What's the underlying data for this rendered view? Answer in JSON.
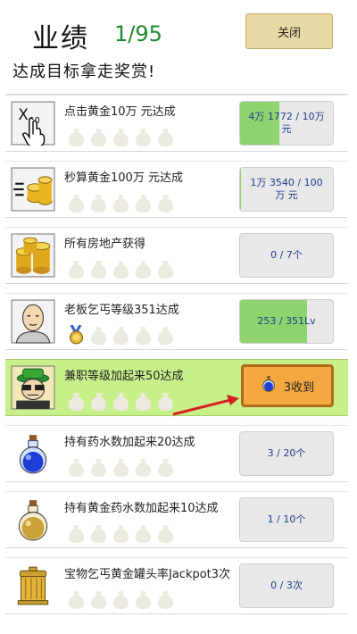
{
  "header": {
    "title": "业绩",
    "progress": "1/95",
    "close_label": "关闭",
    "subtitle": "达成目标拿走奖赏!"
  },
  "colors": {
    "highlight_row": "#c8f08a",
    "progress_fill": "#8fd36e",
    "claim_button": "#f6a840",
    "count_green": "#1e8a2e",
    "arrow": "#d62020"
  },
  "achievements": [
    {
      "icon": "tap-finger-icon",
      "title": "点击黄金10万 元达成",
      "progress": "4万 1772 / 10万 元",
      "fill": 0.42,
      "medal": false,
      "bags": 5
    },
    {
      "icon": "coin-stack-speed-icon",
      "title": "秒算黄金100万 元达成",
      "progress": "1万 3540 / 100万 元",
      "fill": 0.01,
      "medal": false,
      "bags": 5
    },
    {
      "icon": "gold-coin-stack-icon",
      "title": "所有房地产获得",
      "progress": "0 / 7个",
      "fill": 0,
      "medal": false,
      "bags": 5
    },
    {
      "icon": "boss-beggar-icon",
      "title": "老板乞丐等级351达成",
      "progress": "253 / 351Lv",
      "fill": 0.72,
      "medal": true,
      "bags": 5
    },
    {
      "icon": "part-time-worker-icon",
      "title": "兼职等级加起来50达成",
      "claim": "3收到",
      "highlight": true,
      "medal": false,
      "bags": 5
    },
    {
      "icon": "blue-potion-icon",
      "title": "持有药水数加起来20达成",
      "progress": "3 / 20个",
      "fill": 0,
      "medal": false,
      "bags": 5
    },
    {
      "icon": "gold-potion-icon",
      "title": "持有黄金药水数加起来10达成",
      "progress": "1 / 10个",
      "fill": 0,
      "medal": false,
      "bags": 5
    },
    {
      "icon": "golden-pot-icon",
      "title": "宝物乞丐黄金罐头率Jackpot3次",
      "progress": "0 / 3次",
      "fill": 0,
      "medal": false,
      "bags": 5
    }
  ]
}
